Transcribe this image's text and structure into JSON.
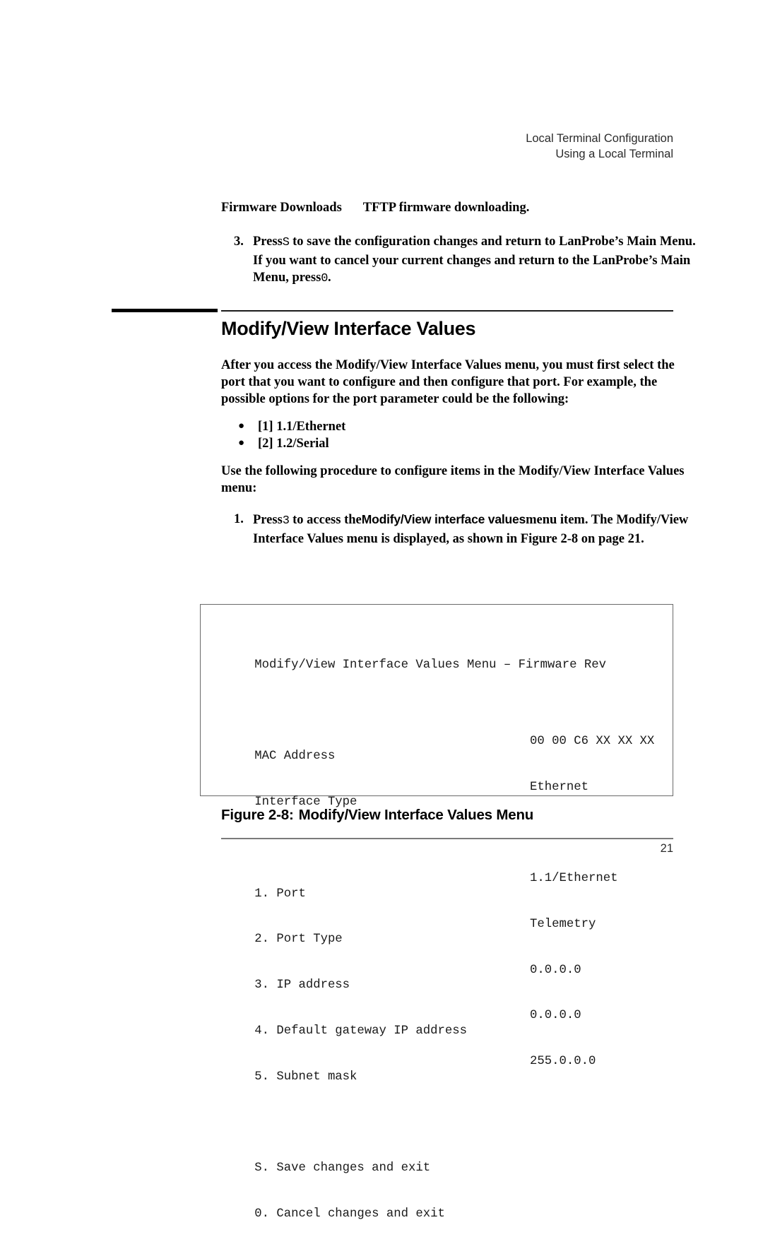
{
  "header": {
    "line1": "Local Terminal Configuration",
    "line2": "Using a Local Terminal"
  },
  "definition": {
    "term": "Firmware Downloads",
    "description": "TFTP firmware downloading."
  },
  "step3": {
    "number": "3.",
    "text_part1": "Press",
    "key1": "S",
    "text_part2": "to save the configuration changes and return to LanProbe’s Main Menu. If you want to cancel your current changes and return to the LanProbe’s Main Menu, press",
    "key2": "0",
    "text_part3": "."
  },
  "section": {
    "title": "Modify/View Interface Values",
    "intro": "After you access the Modify/View Interface Values menu, you must first select the port that you want to configure and then configure that port. For example, the possible options for the port parameter could be the following:"
  },
  "bullets": [
    {
      "marker": "●",
      "label": "[1] 1.1/Ethernet"
    },
    {
      "marker": "●",
      "label": "[2] 1.2/Serial"
    }
  ],
  "procedure_intro": "Use the following procedure to configure items in the Modify/View Interface Values menu:",
  "step1": {
    "number": "1.",
    "text_part1": "Press",
    "key1": "3",
    "text_part2": "to access the",
    "ui_item": "Modify/View interface values",
    "text_part3": "menu item. The Modify/View Interface Values menu is displayed, as shown in Figure 2-8 on page 21."
  },
  "terminal": {
    "title": "Modify/View Interface Values Menu – Firmware Rev",
    "rows": [
      {
        "label": "MAC Address",
        "value": "00 00 C6 XX XX XX"
      },
      {
        "label": "Interface Type",
        "value": "Ethernet"
      },
      {
        "label": "",
        "value": ""
      },
      {
        "label": "1. Port",
        "value": "1.1/Ethernet"
      },
      {
        "label": "2. Port Type",
        "value": "Telemetry"
      },
      {
        "label": "3. IP address",
        "value": "0.0.0.0"
      },
      {
        "label": "4. Default gateway IP address",
        "value": "0.0.0.0"
      },
      {
        "label": "5. Subnet mask",
        "value": "255.0.0.0"
      },
      {
        "label": "",
        "value": ""
      },
      {
        "label": "S. Save changes and exit",
        "value": ""
      },
      {
        "label": "0. Cancel changes and exit",
        "value": ""
      }
    ]
  },
  "figure": {
    "number": "Figure 2-8:",
    "caption": "Modify/View Interface Values Menu"
  },
  "footer": {
    "page_number": "21"
  }
}
